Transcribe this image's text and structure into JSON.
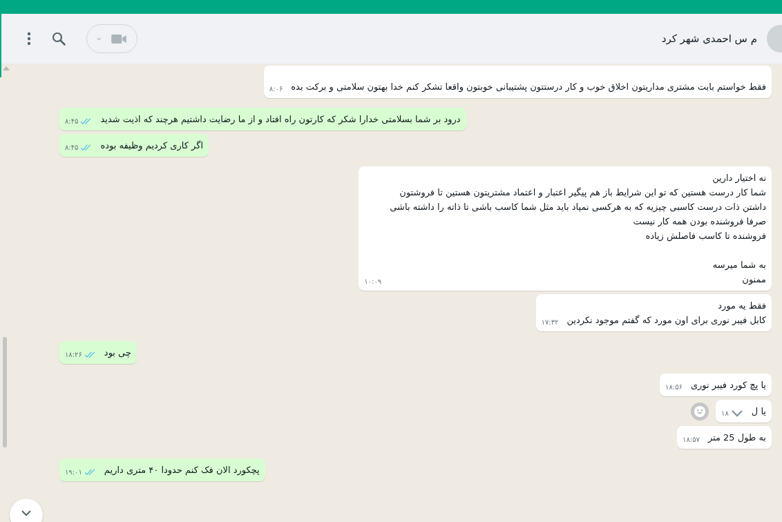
{
  "header": {
    "contact_name": "م س احمدی شهر کرد"
  },
  "messages": [
    {
      "kind": "incoming",
      "text": "فقط خواستم بابت مشتری مداریتون اخلاق خوب و کار درستتون پشتیبانی خوبتون واقعا تشکر کنم خدا بهتون سلامتی و برکت بده",
      "time": "۸:۰۶"
    },
    {
      "kind": "outgoing",
      "text": "درود بر شما بسلامتی خدارا شکر که کارتون راه افتاد و از ما رضایت داشتیم هرچند که اذیت شدید",
      "time": "۸:۴۵",
      "read": true
    },
    {
      "kind": "outgoing",
      "text": "اگر کاری کردیم وظیفه بوده",
      "time": "۸:۴۵",
      "read": true
    },
    {
      "kind": "incoming",
      "text": "نه اختیار دارین\nشما کار درست هستین که تو این شرایط باز هم پیگیر اعتبار و اعتماد مشتریتون هستین تا فروشتون\nداشتن ذات درست کاسبی چیزیه که به هرکسی نمیاد باید مثل شما کاسب باشی تا ذاته را داشته باشی\nصرفا فروشنده بودن همه کار نیست\nفروشنده تا کاسب فاصلش زیاده\n\nبه شما میرسه\nممنون",
      "time": "۱۰:۰۹"
    },
    {
      "kind": "incoming",
      "text": "فقط یه مورد\nکابل فیبر نوری برای اون مورد که گفتم موجود نکردین",
      "time": "۱۷:۳۲"
    },
    {
      "kind": "outgoing",
      "text": "چی بود",
      "time": "۱۸:۲۶",
      "read": true
    },
    {
      "kind": "incoming",
      "text": "یا پچ کورد فیبر نوری",
      "time": "۱۸:۵۶"
    },
    {
      "kind": "incoming",
      "text": "یا ل",
      "time": "۱۸",
      "hovered": true
    },
    {
      "kind": "incoming",
      "text": "به طول 25 متر",
      "time": "۱۸:۵۷"
    },
    {
      "kind": "outgoing",
      "text": "پچکورد الان فک کنم حدودا ۴۰ متری داریم",
      "time": "۱۹:۰۱",
      "read": true
    }
  ]
}
